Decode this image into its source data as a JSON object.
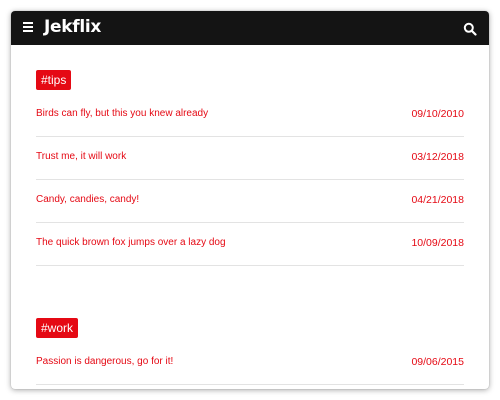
{
  "navbar": {
    "brand": "Jekflix",
    "menu_icon": "hamburger-menu-icon",
    "search_icon": "search-icon"
  },
  "colors": {
    "accent": "#e50914",
    "navbar_bg": "#141414",
    "divider": "#e3e3e3"
  },
  "sections": [
    {
      "tag": "#tips",
      "posts": [
        {
          "title": "Birds can fly, but this you knew already",
          "date": "09/10/2010"
        },
        {
          "title": "Trust me, it will work",
          "date": "03/12/2018"
        },
        {
          "title": "Candy, candies, candy!",
          "date": "04/21/2018"
        },
        {
          "title": "The quick brown fox jumps over a lazy dog",
          "date": "10/09/2018"
        }
      ]
    },
    {
      "tag": "#work",
      "posts": [
        {
          "title": "Passion is dangerous, go for it!",
          "date": "09/06/2015"
        }
      ]
    }
  ]
}
